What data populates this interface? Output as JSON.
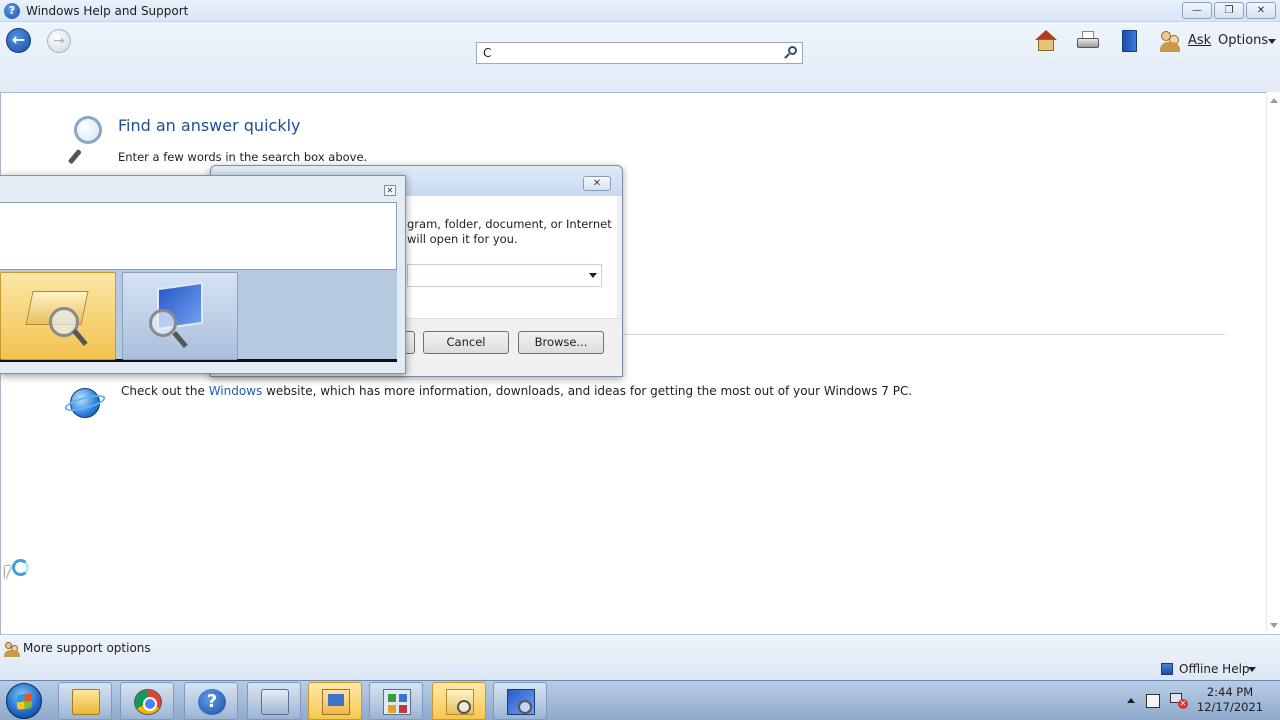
{
  "window": {
    "title": "Windows Help and Support",
    "minimize_label": "—",
    "restore_label": "❐",
    "close_label": "✕"
  },
  "toolbar": {
    "back_label": "←",
    "forward_label": "→",
    "icons": [
      "home-icon",
      "print-icon",
      "browse-help-icon",
      "ask-icon"
    ],
    "ask_label": "Ask",
    "options_label": "Options"
  },
  "search": {
    "value": "C",
    "icon": "search-icon"
  },
  "main": {
    "find_title": "Find an answer quickly",
    "find_desc": "Enter a few words in the search box above.",
    "website_prefix": "Check out the ",
    "website_link": "Windows",
    "website_suffix": " website, which has more information, downloads, and ideas for getting the most out of your Windows 7 PC."
  },
  "run_dialog": {
    "desc_line1": "gram, folder, document, or Internet",
    "desc_line2": "will open it for you.",
    "close_label": "✕",
    "cancel_label": "Cancel",
    "browse_label": "Browse..."
  },
  "search_popup": {
    "close_label": "✕",
    "results": [
      "search-folders-icon",
      "search-computer-icon"
    ]
  },
  "support_bar": {
    "more_support_label": "More support options",
    "offline_help_label": "Offline Help"
  },
  "taskbar": {
    "apps": [
      "file-explorer",
      "chrome",
      "help-and-support",
      "remote-app",
      "display-app",
      "control-panel",
      "search-folders",
      "search-computer"
    ],
    "help_glyph": "?",
    "net_x": "✕",
    "time": "2:44 PM",
    "date": "12/17/2021"
  },
  "colors": {
    "link": "#1e5fb4",
    "heading": "#1e4f93",
    "active_task": "#f4c752"
  }
}
